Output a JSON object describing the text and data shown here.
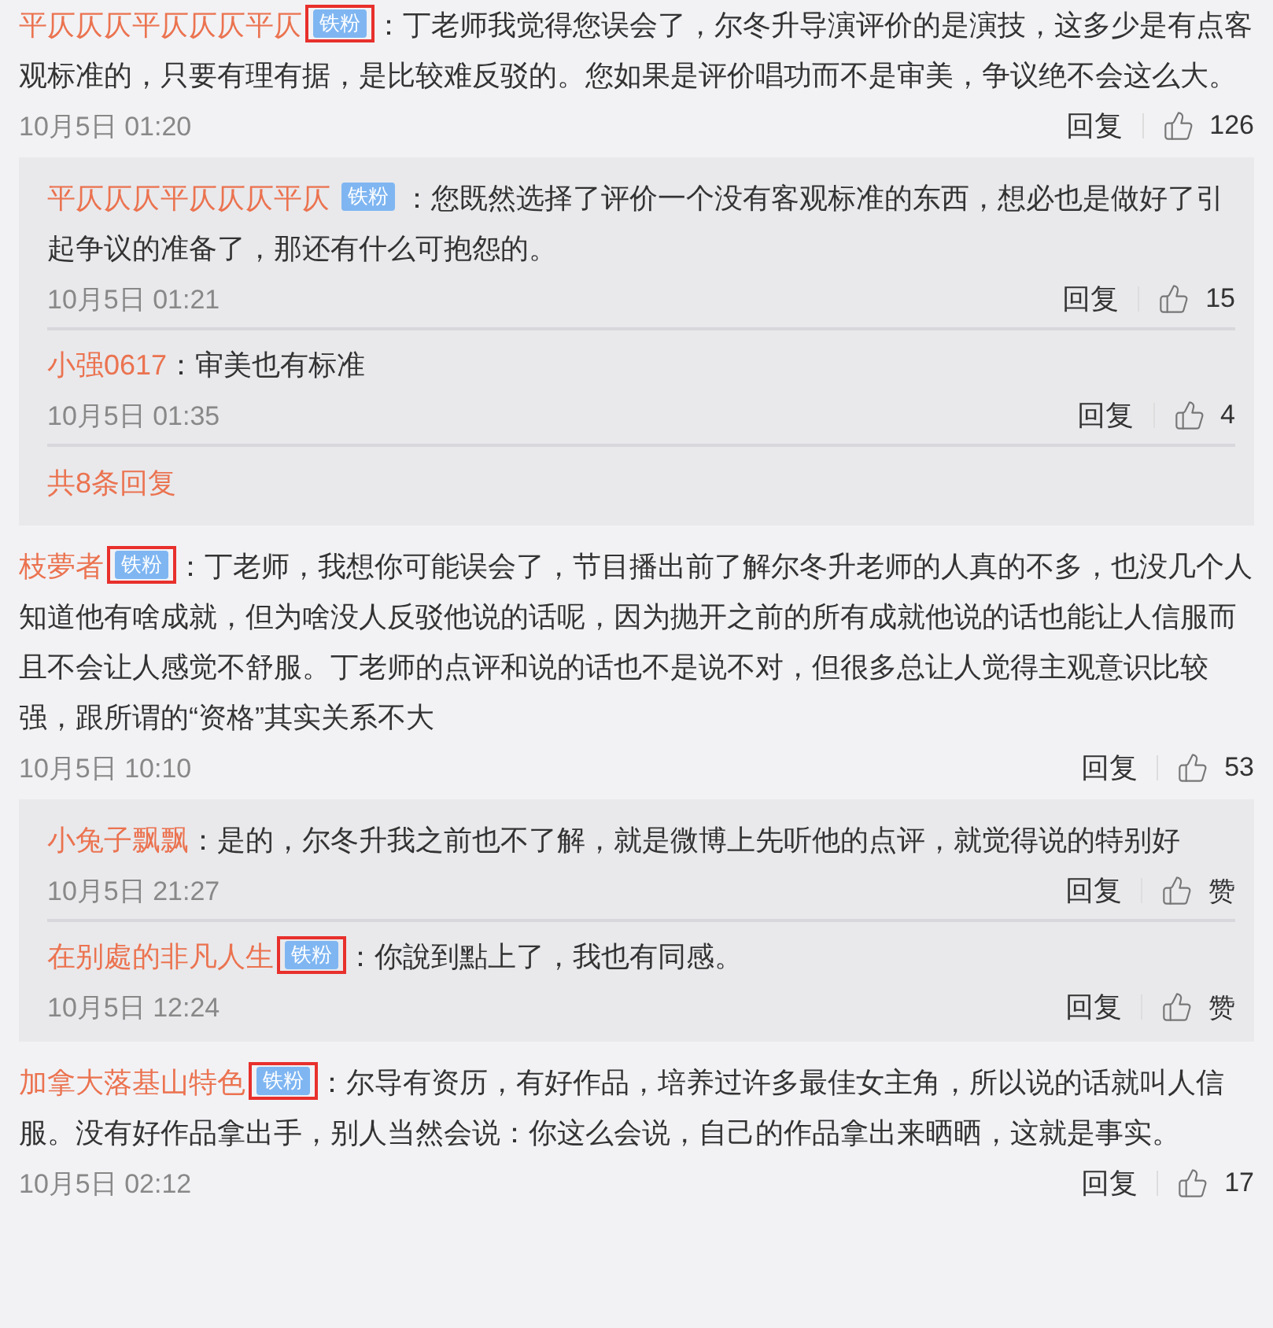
{
  "comments": [
    {
      "author": "平仄仄仄平仄仄仄平仄",
      "badge": {
        "label": "铁粉",
        "highlighted": true
      },
      "separator": "：",
      "text": "丁老师我觉得您误会了，尔冬升导演评价的是演技，这多少是有点客观标准的，只要有理有据，是比较难反驳的。您如果是评价唱功而不是审美，争议绝不会这么大。",
      "date": "10月5日 01:20",
      "reply_label": "回复",
      "likes": "126",
      "replies": [
        {
          "author": "平仄仄仄平仄仄仄平仄",
          "badge": {
            "label": "铁粉",
            "highlighted": false
          },
          "separator": "：",
          "text": "您既然选择了评价一个没有客观标准的东西，想必也是做好了引起争议的准备了，那还有什么可抱怨的。",
          "date": "10月5日 01:21",
          "reply_label": "回复",
          "likes": "15"
        },
        {
          "author": "小强0617",
          "separator": "：",
          "text": "审美也有标准",
          "date": "10月5日 01:35",
          "reply_label": "回复",
          "likes": "4"
        }
      ],
      "more_replies": "共8条回复"
    },
    {
      "author": "枝夢者",
      "badge": {
        "label": "铁粉",
        "highlighted": true
      },
      "separator": "：",
      "text": "丁老师，我想你可能误会了，节目播出前了解尔冬升老师的人真的不多，也没几个人知道他有啥成就，但为啥没人反驳他说的话呢，因为抛开之前的所有成就他说的话也能让人信服而且不会让人感觉不舒服。丁老师的点评和说的话也不是说不对，但很多总让人觉得主观意识比较强，跟所谓的“资格”其实关系不大",
      "date": "10月5日 10:10",
      "reply_label": "回复",
      "likes": "53",
      "replies": [
        {
          "author": "小兔子飘飘",
          "separator": "：",
          "text": "是的，尔冬升我之前也不了解，就是微博上先听他的点评，就觉得说的特别好",
          "date": "10月5日 21:27",
          "reply_label": "回复",
          "likes": "赞"
        },
        {
          "author": "在别處的非凡人生",
          "badge": {
            "label": "铁粉",
            "highlighted": true
          },
          "separator": "：",
          "text": "你說到點上了，我也有同感。",
          "date": "10月5日 12:24",
          "reply_label": "回复",
          "likes": "赞"
        }
      ]
    },
    {
      "author": "加拿大落基山特色",
      "badge": {
        "label": "铁粉",
        "highlighted": true
      },
      "separator": "：",
      "text": "尔导有资历，有好作品，培养过许多最佳女主角，所以说的话就叫人信服。没有好作品拿出手，别人当然会说：你这么会说，自己的作品拿出来晒晒，这就是事实。",
      "date": "10月5日 02:12",
      "reply_label": "回复",
      "likes": "17"
    }
  ]
}
